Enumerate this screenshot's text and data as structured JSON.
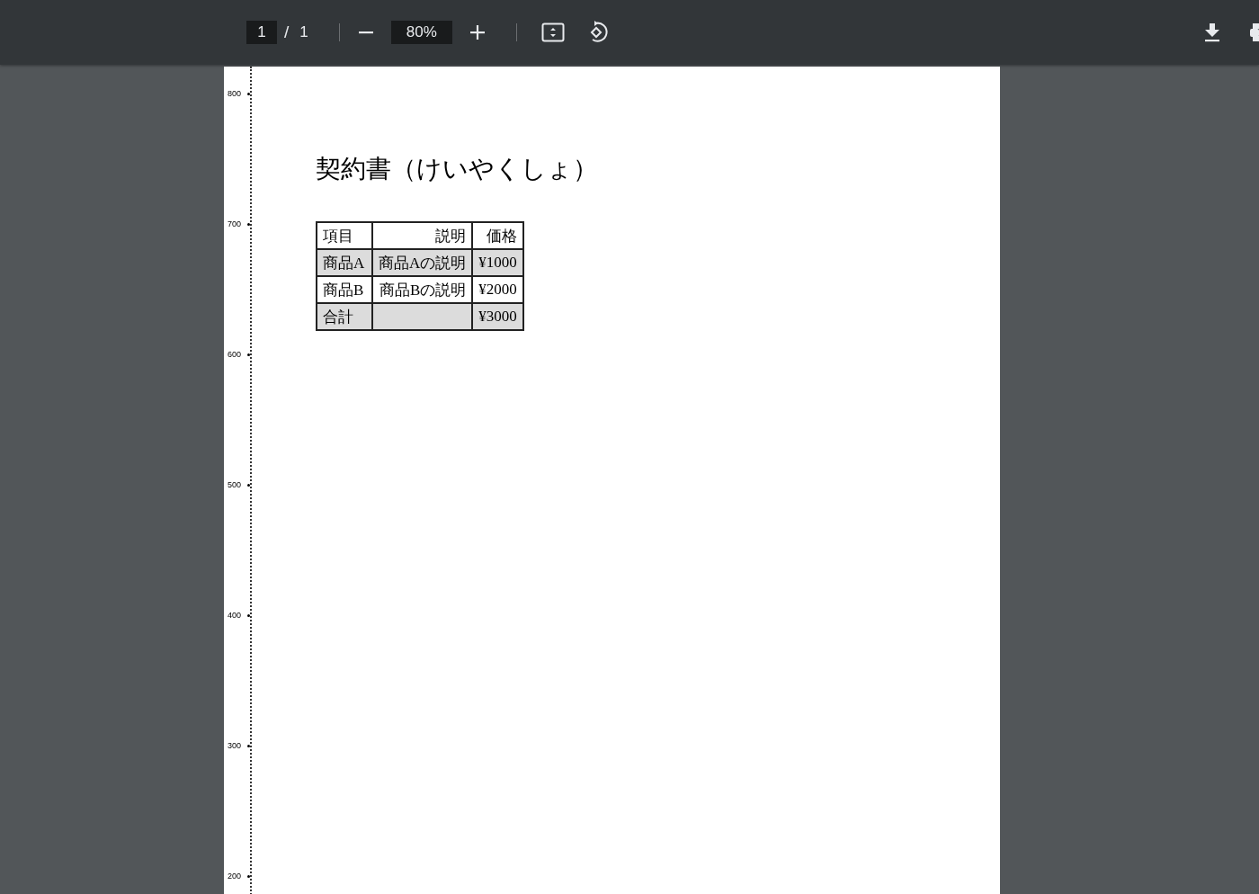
{
  "toolbar": {
    "page_current": "1",
    "page_separator": "/",
    "page_total": "1",
    "zoom": "80%"
  },
  "document": {
    "ruler_ticks": [
      "800",
      "700",
      "600",
      "500",
      "400",
      "300",
      "200"
    ],
    "title": "契約書（けいやくしょ）",
    "table": {
      "columns": [
        "項目",
        "説明",
        "価格"
      ],
      "rows": [
        {
          "cells": [
            "商品A",
            "商品Aの説明",
            "¥1000"
          ],
          "shaded": true
        },
        {
          "cells": [
            "商品B",
            "商品Bの説明",
            "¥2000"
          ],
          "shaded": false
        },
        {
          "cells": [
            "合計",
            "",
            "¥3000"
          ],
          "shaded": true
        }
      ]
    }
  }
}
